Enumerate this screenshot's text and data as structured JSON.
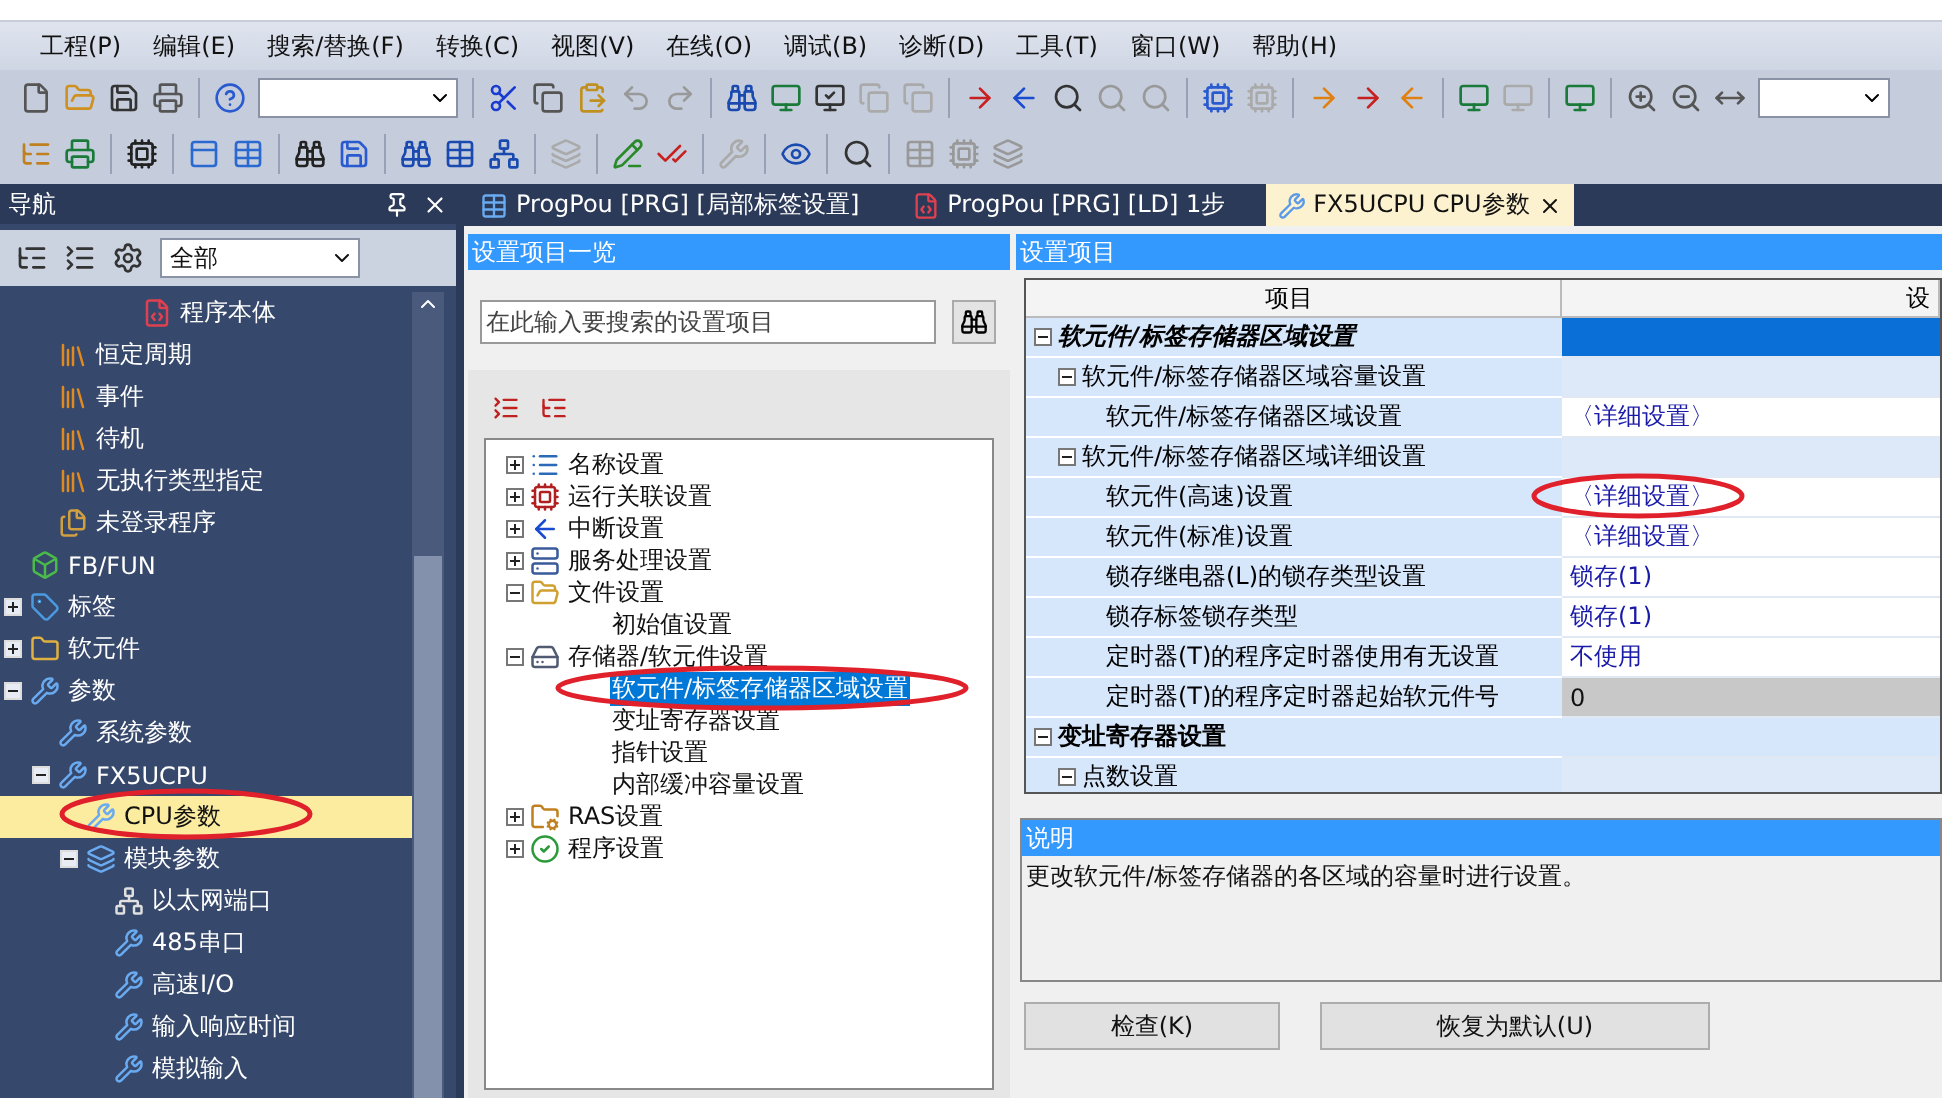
{
  "menu": [
    "工程(P)",
    "编辑(E)",
    "搜索/替换(F)",
    "转换(C)",
    "视图(V)",
    "在线(O)",
    "调试(B)",
    "诊断(D)",
    "工具(T)",
    "窗口(W)",
    "帮助(H)"
  ],
  "nav": {
    "title": "导航",
    "filter": "全部",
    "tree": [
      {
        "children": [
          {
            "children": [
              {
                "children": [
                  {
                    "children": [
                      {
                        "label": "程序本体",
                        "kind": "program",
                        "selected": false
                      }
                    ]
                  }
                ]
              }
            ]
          },
          {
            "label": "恒定周期",
            "kind": "task",
            "selected": false
          },
          {
            "label": "事件",
            "kind": "task",
            "selected": false
          },
          {
            "label": "待机",
            "kind": "task",
            "selected": false
          },
          {
            "label": "无执行类型指定",
            "kind": "task",
            "selected": false
          },
          {
            "label": "未登录程序",
            "kind": "unregistered",
            "selected": false
          }
        ]
      },
      {
        "label": "FB/FUN",
        "kind": "fb",
        "selected": false
      },
      {
        "label": "标签",
        "kind": "label",
        "expanded": false,
        "selected": false
      },
      {
        "label": "软元件",
        "kind": "device",
        "expanded": false,
        "selected": false
      },
      {
        "label": "参数",
        "kind": "param",
        "expanded": true,
        "selected": false,
        "children": [
          {
            "label": "系统参数",
            "kind": "param",
            "selected": false
          },
          {
            "label": "FX5UCPU",
            "kind": "param",
            "expanded": true,
            "selected": false,
            "children": [
              {
                "label": "CPU参数",
                "kind": "param",
                "selected": true
              },
              {
                "label": "模块参数",
                "kind": "module",
                "expanded": true,
                "selected": false,
                "children": [
                  {
                    "label": "以太网端口",
                    "kind": "network",
                    "selected": false
                  },
                  {
                    "label": "485串口",
                    "kind": "param",
                    "selected": false
                  },
                  {
                    "label": "高速I/O",
                    "kind": "param",
                    "selected": false
                  },
                  {
                    "label": "输入响应时间",
                    "kind": "param",
                    "selected": false
                  },
                  {
                    "label": "模拟输入",
                    "kind": "param",
                    "selected": false
                  }
                ]
              }
            ]
          }
        ]
      }
    ]
  },
  "tabs": [
    {
      "label": "ProgPou [PRG] [局部标签设置]",
      "kind": "label",
      "selected": false
    },
    {
      "label": "ProgPou [PRG] [LD] 1步",
      "kind": "program",
      "selected": false
    },
    {
      "label": "FX5UCPU CPU参数",
      "kind": "param",
      "selected": true
    }
  ],
  "settings_list": {
    "title": "设置项目一览",
    "search": {
      "placeholder": "在此输入要搜索的设置项目"
    },
    "tree": [
      {
        "label": "名称设置",
        "kind": "list",
        "expanded": false,
        "selected": false
      },
      {
        "label": "运行关联设置",
        "kind": "run",
        "expanded": false,
        "selected": false
      },
      {
        "label": "中断设置",
        "kind": "interrupt",
        "expanded": false,
        "selected": false
      },
      {
        "label": "服务处理设置",
        "kind": "service",
        "expanded": false,
        "selected": false
      },
      {
        "label": "文件设置",
        "kind": "folder",
        "expanded": true,
        "selected": false,
        "children": [
          {
            "label": "初始值设置",
            "selected": false
          }
        ]
      },
      {
        "label": "存储器/软元件设置",
        "kind": "memory",
        "expanded": true,
        "selected": false,
        "children": [
          {
            "label": "软元件/标签存储器区域设置",
            "selected": true
          },
          {
            "label": "变址寄存器设置",
            "selected": false
          },
          {
            "label": "指针设置",
            "selected": false
          },
          {
            "label": "内部缓冲容量设置",
            "selected": false
          }
        ]
      },
      {
        "label": "RAS设置",
        "kind": "ras",
        "expanded": false,
        "selected": false
      },
      {
        "label": "程序设置",
        "kind": "check",
        "expanded": false,
        "selected": false
      }
    ]
  },
  "settings": {
    "title": "设置项目",
    "columns": [
      "项目",
      "设"
    ],
    "rows": [
      {
        "label": "软元件/标签存储器区域设置",
        "kind": "group",
        "expanded": true,
        "selected": true,
        "children": [
          {
            "label": "软元件/标签存储器区域容量设置",
            "kind": "section",
            "expanded": true,
            "selected": false,
            "children": [
              {
                "label": "软元件/标签存储器区域设置",
                "kind": "item",
                "value": "〈详细设置〉",
                "disabled": false,
                "selected": false
              }
            ]
          },
          {
            "label": "软元件/标签存储器区域详细设置",
            "kind": "section",
            "expanded": true,
            "selected": false,
            "children": [
              {
                "label": "软元件(高速)设置",
                "kind": "item",
                "value": "〈详细设置〉",
                "disabled": false,
                "selected": false
              },
              {
                "label": "软元件(标准)设置",
                "kind": "item",
                "value": "〈详细设置〉",
                "disabled": false,
                "selected": false
              },
              {
                "label": "锁存继电器(L)的锁存类型设置",
                "kind": "item",
                "value": "锁存(1)",
                "disabled": false,
                "selected": false
              },
              {
                "label": "锁存标签锁存类型",
                "kind": "item",
                "value": "锁存(1)",
                "disabled": false,
                "selected": false
              },
              {
                "label": "定时器(T)的程序定时器使用有无设置",
                "kind": "item",
                "value": "不使用",
                "disabled": false,
                "selected": false
              },
              {
                "label": "定时器(T)的程序定时器起始软元件号",
                "kind": "item",
                "value": "0",
                "disabled": true,
                "selected": false
              }
            ]
          }
        ]
      },
      {
        "label": "变址寄存器设置",
        "kind": "group",
        "expanded": true,
        "selected": false,
        "children": [
          {
            "label": "点数设置",
            "kind": "section",
            "expanded": true,
            "selected": false
          }
        ]
      }
    ]
  },
  "description": {
    "title": "说明",
    "text": "更改软元件/标签存储器的各区域的容量时进行设置。"
  },
  "buttons": [
    "检查(K)",
    "恢复为默认(U)"
  ]
}
